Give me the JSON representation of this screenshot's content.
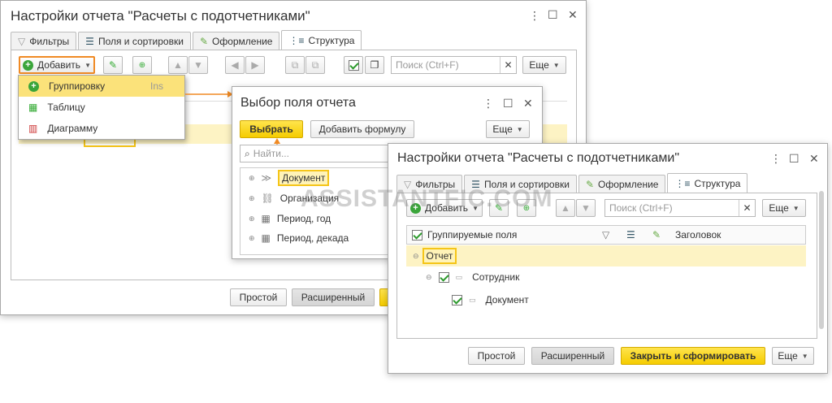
{
  "window1": {
    "title": "Настройки отчета \"Расчеты с подотчетниками\"",
    "tabs": [
      "Фильтры",
      "Поля и сортировки",
      "Оформление",
      "Структура"
    ],
    "add_label": "Добавить",
    "search_placeholder": "Поиск (Ctrl+F)",
    "more_label": "Еще",
    "simple_label": "Простой",
    "advanced_label": "Расширенный"
  },
  "add_menu": {
    "items": [
      {
        "label": "Группировку",
        "shortcut": "Ins"
      },
      {
        "label": "Таблицу",
        "shortcut": ""
      },
      {
        "label": "Диаграмму",
        "shortcut": ""
      }
    ]
  },
  "window2": {
    "title": "Выбор поля отчета",
    "select_label": "Выбрать",
    "add_formula_label": "Добавить формулу",
    "more_label": "Еще",
    "search_placeholder": "Найти...",
    "fields": [
      "Документ",
      "Организация",
      "Период, год",
      "Период, декада"
    ]
  },
  "window3": {
    "title": "Настройки отчета \"Расчеты с подотчетниками\"",
    "tabs": [
      "Фильтры",
      "Поля и сортировки",
      "Оформление",
      "Структура"
    ],
    "add_label": "Добавить",
    "search_placeholder": "Поиск (Ctrl+F)",
    "more_label": "Еще",
    "col_grouped": "Группируемые поля",
    "col_header": "Заголовок",
    "rows": [
      "Отчет",
      "Сотрудник",
      "Документ"
    ],
    "simple_label": "Простой",
    "advanced_label": "Расширенный",
    "close_label": "Закрыть и сформировать",
    "more_bottom_label": "Еще"
  },
  "watermark": "ASSISTANTFIC.COM",
  "colors": {
    "accent_yellow": "#f5cc00",
    "orange": "#f08a24",
    "green": "#3aa53a",
    "selection": "#fbe27a"
  }
}
